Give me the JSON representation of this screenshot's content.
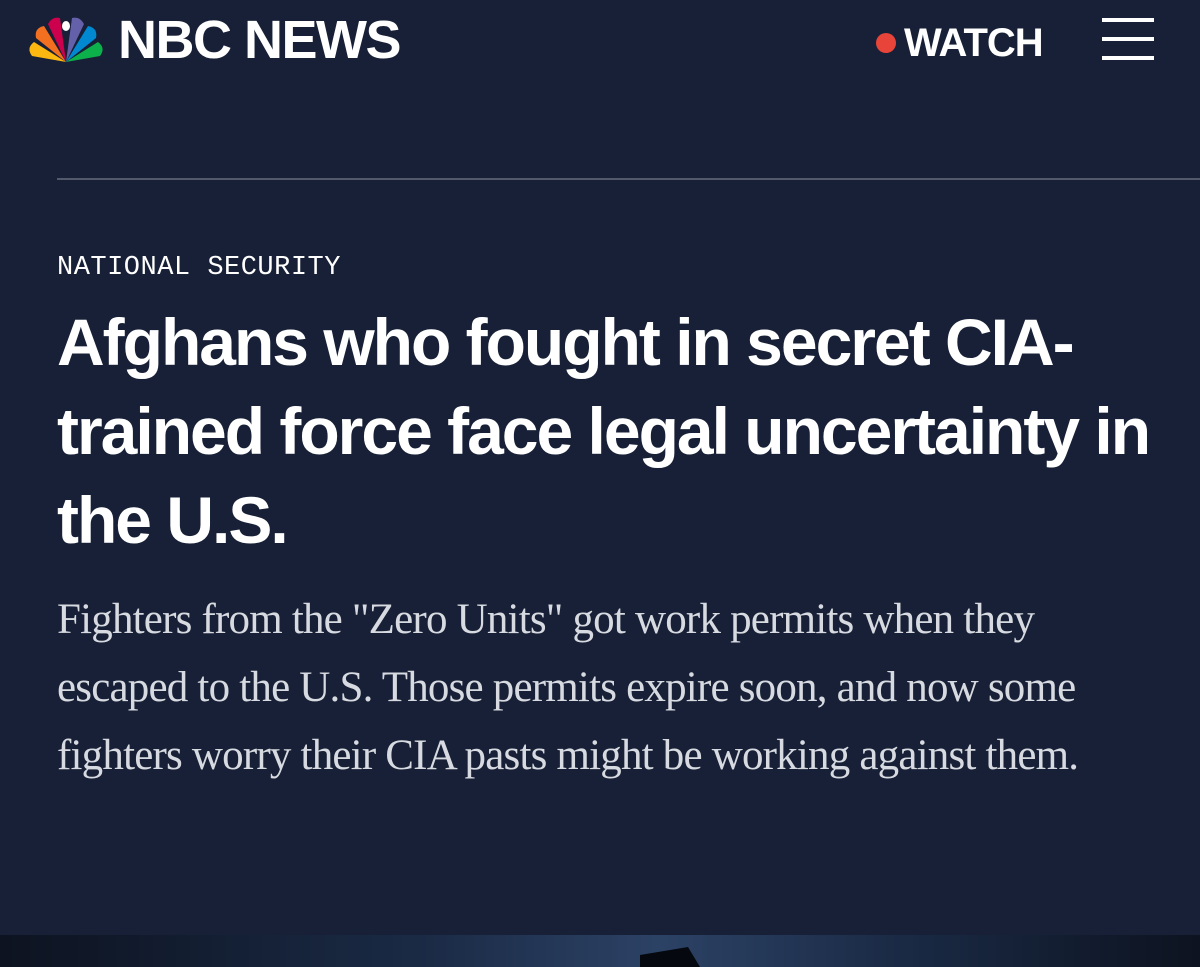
{
  "header": {
    "brand": "NBC NEWS",
    "watch_label": "WATCH",
    "live_dot_color": "#e8443a",
    "menu_icon": "hamburger-menu-icon",
    "logo_icon": "nbc-peacock-icon"
  },
  "article": {
    "section": "NATIONAL SECURITY",
    "headline": "Afghans who fought in secret CIA-trained force face legal uncertainty in the U.S.",
    "dek": "Fighters from the \"Zero Units\" got work permits when they escaped to the U.S. Those permits expire soon, and now some fighters worry their CIA pasts might be working against them."
  },
  "colors": {
    "background": "#172036",
    "text": "#ffffff",
    "dek_text": "#d7dae0",
    "divider": "#52596a"
  }
}
